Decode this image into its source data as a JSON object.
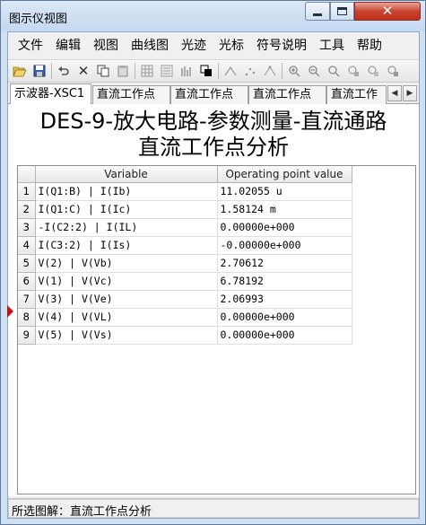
{
  "window": {
    "title": "图示仪视图"
  },
  "menu": [
    "文件",
    "编辑",
    "视图",
    "曲线图",
    "光迹",
    "光标",
    "符号说明",
    "工具",
    "帮助"
  ],
  "toolbar": {
    "icons": [
      "open-folder-icon",
      "save-icon",
      "undo-icon",
      "delete-icon",
      "copy-icon",
      "paste-icon",
      "grid-icon",
      "legend-icon",
      "bar-chart-icon",
      "overlay-icon",
      "trace-icon",
      "cursor-icon",
      "cursor-pair-icon",
      "zoom-in-icon",
      "zoom-out-icon",
      "zoom-fit-icon",
      "export-icon",
      "export-alt-icon",
      "print-icon"
    ]
  },
  "tabs": [
    "示波器-XSC1",
    "直流工作点",
    "直流工作点",
    "直流工作点",
    "直流工作"
  ],
  "graph": {
    "title_line1": "DES-9-放大电路-参数测量-直流通路",
    "title_line2": "直流工作点分析",
    "columns": {
      "variable": "Variable",
      "value": "Operating point value"
    },
    "rows": [
      {
        "n": "1",
        "variable": "I(Q1:B) | I(Ib)",
        "value": "11.02055 u"
      },
      {
        "n": "2",
        "variable": "I(Q1:C) | I(Ic)",
        "value": "1.58124 m"
      },
      {
        "n": "3",
        "variable": "-I(C2:2) | I(IL)",
        "value": "0.00000e+000"
      },
      {
        "n": "4",
        "variable": "I(C3:2) | I(Is)",
        "value": "-0.00000e+000"
      },
      {
        "n": "5",
        "variable": "V(2) | V(Vb)",
        "value": "2.70612"
      },
      {
        "n": "6",
        "variable": "V(1) | V(Vc)",
        "value": "6.78192"
      },
      {
        "n": "7",
        "variable": "V(3) | V(Ve)",
        "value": "2.06993"
      },
      {
        "n": "8",
        "variable": "V(4) | V(VL)",
        "value": "0.00000e+000"
      },
      {
        "n": "9",
        "variable": "V(5) | V(Vs)",
        "value": "0.00000e+000"
      }
    ]
  },
  "status": {
    "text": "所选图解：直流工作点分析"
  }
}
